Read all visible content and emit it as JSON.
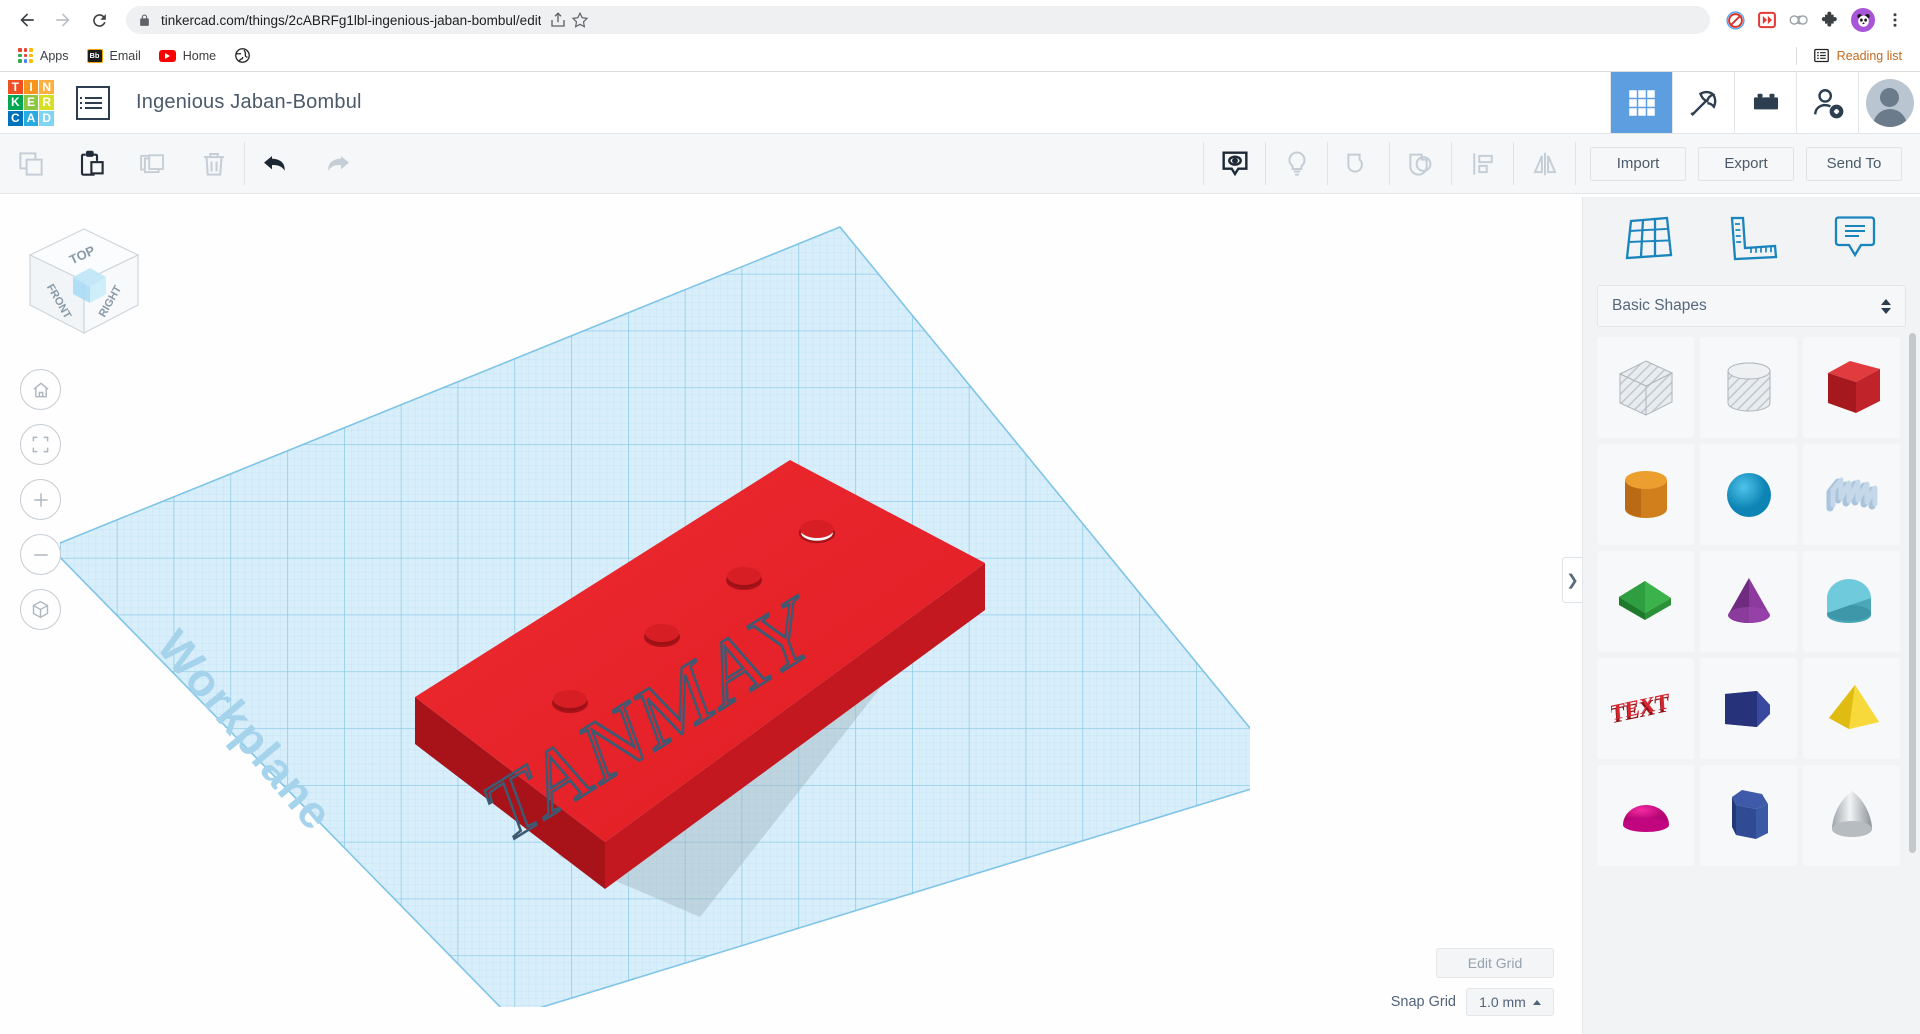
{
  "browser": {
    "back_icon": "back-arrow-icon",
    "forward_icon": "forward-arrow-icon",
    "reload_icon": "reload-icon",
    "url": "tinkercad.com/things/2cABRFg1lbl-ingenious-jaban-bombul/edit",
    "lock_icon": "lock-icon",
    "share_icon": "share-icon",
    "bookmark_icon": "star-icon",
    "extensions": [
      {
        "name": "adblock-extension-icon",
        "color": "#d93025"
      },
      {
        "name": "fast-forward-extension-icon",
        "color": "#e53935"
      },
      {
        "name": "link-extension-icon",
        "color": "#9aa0a6"
      },
      {
        "name": "puzzle-extension-icon",
        "color": "#3c4043"
      },
      {
        "name": "panda-profile-icon",
        "color": "#a855d8"
      }
    ],
    "menu_icon": "three-dot-menu-icon",
    "bookmarks": [
      {
        "label": "Apps",
        "icon": "apps-grid-icon"
      },
      {
        "label": "Email",
        "icon": "blackboard-icon"
      },
      {
        "label": "Home",
        "icon": "youtube-icon"
      },
      {
        "label": "",
        "icon": "globe-icon"
      }
    ],
    "reading_list": {
      "label": "Reading list",
      "icon": "reading-list-icon"
    }
  },
  "tinkercad": {
    "logo_tiles": [
      {
        "letter": "T",
        "color": "#f04e23"
      },
      {
        "letter": "I",
        "color": "#f7941e"
      },
      {
        "letter": "N",
        "color": "#fbb040"
      },
      {
        "letter": "K",
        "color": "#00a651"
      },
      {
        "letter": "E",
        "color": "#8dc63f"
      },
      {
        "letter": "R",
        "color": "#d7df23"
      },
      {
        "letter": "C",
        "color": "#0072bc"
      },
      {
        "letter": "A",
        "color": "#29abe2"
      },
      {
        "letter": "D",
        "color": "#7fd4f2"
      }
    ],
    "menu_icon": "project-list-icon",
    "project_title": "Ingenious Jaban-Bombul",
    "header_icons": [
      {
        "name": "designs-grid-icon",
        "active": true
      },
      {
        "name": "pickaxe-minecraft-icon",
        "active": false
      },
      {
        "name": "lego-brick-icon",
        "active": false
      },
      {
        "name": "invite-person-icon",
        "active": false
      }
    ],
    "avatar": "user-avatar"
  },
  "toolbar": {
    "left_tools": [
      {
        "name": "copy-button",
        "enabled": false
      },
      {
        "name": "paste-button",
        "enabled": true
      },
      {
        "name": "duplicate-button",
        "enabled": false
      },
      {
        "name": "delete-button",
        "enabled": false
      }
    ],
    "history_tools": [
      {
        "name": "undo-button",
        "enabled": true
      },
      {
        "name": "redo-button",
        "enabled": false
      }
    ],
    "view_tools": [
      {
        "name": "show-hide-button",
        "enabled": true
      },
      {
        "name": "lightbulb-hide-button",
        "enabled": false
      },
      {
        "name": "group-button",
        "enabled": false
      },
      {
        "name": "ungroup-button",
        "enabled": false
      },
      {
        "name": "align-button",
        "enabled": false
      },
      {
        "name": "mirror-button",
        "enabled": false
      }
    ],
    "import_label": "Import",
    "export_label": "Export",
    "send_to_label": "Send To"
  },
  "canvas": {
    "view_cube": {
      "top": "TOP",
      "front": "FRONT",
      "right": "RIGHT"
    },
    "nav_buttons": [
      {
        "name": "home-view-button",
        "icon": "home-icon"
      },
      {
        "name": "fit-to-view-button",
        "icon": "fit-frame-icon"
      },
      {
        "name": "zoom-in-button",
        "icon": "plus-icon"
      },
      {
        "name": "zoom-out-button",
        "icon": "minus-icon"
      },
      {
        "name": "perspective-toggle-button",
        "icon": "cube-icon"
      }
    ],
    "workplane_label": "Workplane",
    "model": {
      "engraved_text": "TANMAY",
      "body_color": "#e8232a",
      "engrave_color": "#3d5a72",
      "hole_count": 4
    },
    "edit_grid_label": "Edit Grid",
    "snap_grid_label": "Snap Grid",
    "snap_grid_value": "1.0 mm",
    "panel_toggle_icon": "chevron-right-icon"
  },
  "right_panel": {
    "tabs": [
      {
        "name": "workplane-tab",
        "icon": "grid-plane-icon"
      },
      {
        "name": "ruler-tab",
        "icon": "ruler-icon"
      },
      {
        "name": "notes-tab",
        "icon": "note-bubble-icon"
      }
    ],
    "category_label": "Basic Shapes",
    "shapes": [
      {
        "name": "box-hole",
        "kind": "box",
        "color": "#c8ccd0",
        "hole": true
      },
      {
        "name": "cylinder-hole",
        "kind": "cylinder",
        "color": "#c8ccd0",
        "hole": true
      },
      {
        "name": "box-solid",
        "kind": "box",
        "color": "#cc2229",
        "hole": false
      },
      {
        "name": "cylinder-solid",
        "kind": "cylinder",
        "color": "#e08a1e",
        "hole": false
      },
      {
        "name": "sphere",
        "kind": "sphere",
        "color": "#1a9ccd",
        "hole": false
      },
      {
        "name": "scribble",
        "kind": "scribble",
        "color": "#a9c4dc",
        "hole": false
      },
      {
        "name": "roof",
        "kind": "roof",
        "color": "#2f9e41",
        "hole": false
      },
      {
        "name": "cone",
        "kind": "cone",
        "color": "#8c3a9e",
        "hole": false
      },
      {
        "name": "half-cylinder",
        "kind": "halfcyl",
        "color": "#4aa8b8",
        "hole": false
      },
      {
        "name": "text",
        "kind": "text",
        "color": "#cc2229",
        "hole": false,
        "label": "TEXT"
      },
      {
        "name": "wedge",
        "kind": "wedge",
        "color": "#26327a",
        "hole": false
      },
      {
        "name": "pyramid",
        "kind": "pyramid",
        "color": "#edc417",
        "hole": false
      },
      {
        "name": "dome",
        "kind": "dome",
        "color": "#e0078f",
        "hole": false
      },
      {
        "name": "hex-prism",
        "kind": "hex",
        "color": "#2f4b93",
        "hole": false
      },
      {
        "name": "paraboloid",
        "kind": "parab",
        "color": "#bcc0c4",
        "hole": false
      }
    ]
  }
}
